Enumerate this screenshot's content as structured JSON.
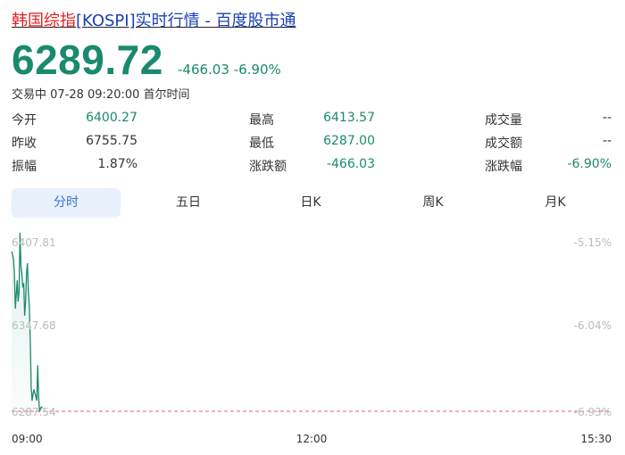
{
  "title": {
    "part1": "韩国综指",
    "part2": "[KOSPI]实时行情 - 百度股市通"
  },
  "quote": {
    "price": "6289.72",
    "change": "-466.03",
    "change_pct": "-6.90%",
    "status": "交易中 07-28 09:20:00 首尔时间"
  },
  "stats": {
    "col1": [
      {
        "label": "今开",
        "value": "6400.27"
      },
      {
        "label": "昨收",
        "value": "6755.75"
      },
      {
        "label": "振幅",
        "value": "1.87%"
      }
    ],
    "col2": [
      {
        "label": "最高",
        "value": "6413.57"
      },
      {
        "label": "最低",
        "value": "6287.00"
      },
      {
        "label": "涨跌额",
        "value": "-466.03"
      }
    ],
    "col3": [
      {
        "label": "成交量",
        "value": "--"
      },
      {
        "label": "成交额",
        "value": "--"
      },
      {
        "label": "涨跌幅",
        "value": "-6.90%"
      }
    ]
  },
  "tabs": [
    "分时",
    "五日",
    "日K",
    "周K",
    "月K"
  ],
  "active_tab": 0,
  "chart_data": {
    "type": "line",
    "y_ticks": [
      "6407.81",
      "6347.68",
      "6287.54"
    ],
    "y_pct_ticks": [
      "-5.15%",
      "-6.04%",
      "-6.93%"
    ],
    "x_ticks": [
      "09:00",
      "12:00",
      "15:30"
    ],
    "ylim": [
      6287.54,
      6407.81
    ],
    "series": [
      {
        "values": [
          6400.27,
          6398.5,
          6395.0,
          6385.0,
          6360.0,
          6370.0,
          6380.0,
          6365.0,
          6372.0,
          6413.57,
          6390.0,
          6385.0,
          6375.0,
          6378.0,
          6355.0,
          6365.0,
          6385.0,
          6392.0,
          6372.0,
          6362.0,
          6338.0,
          6305.0,
          6295.0,
          6300.0,
          6303.0,
          6300.0,
          6298.0,
          6295.0,
          6320.0,
          6298.0,
          6287.0,
          6289.72,
          6290.5,
          6289.72
        ]
      }
    ],
    "colors": {
      "line": "#1a8a6e",
      "grid": "#e06565",
      "muted": "#bbbbbb",
      "axis": "#333333"
    }
  }
}
